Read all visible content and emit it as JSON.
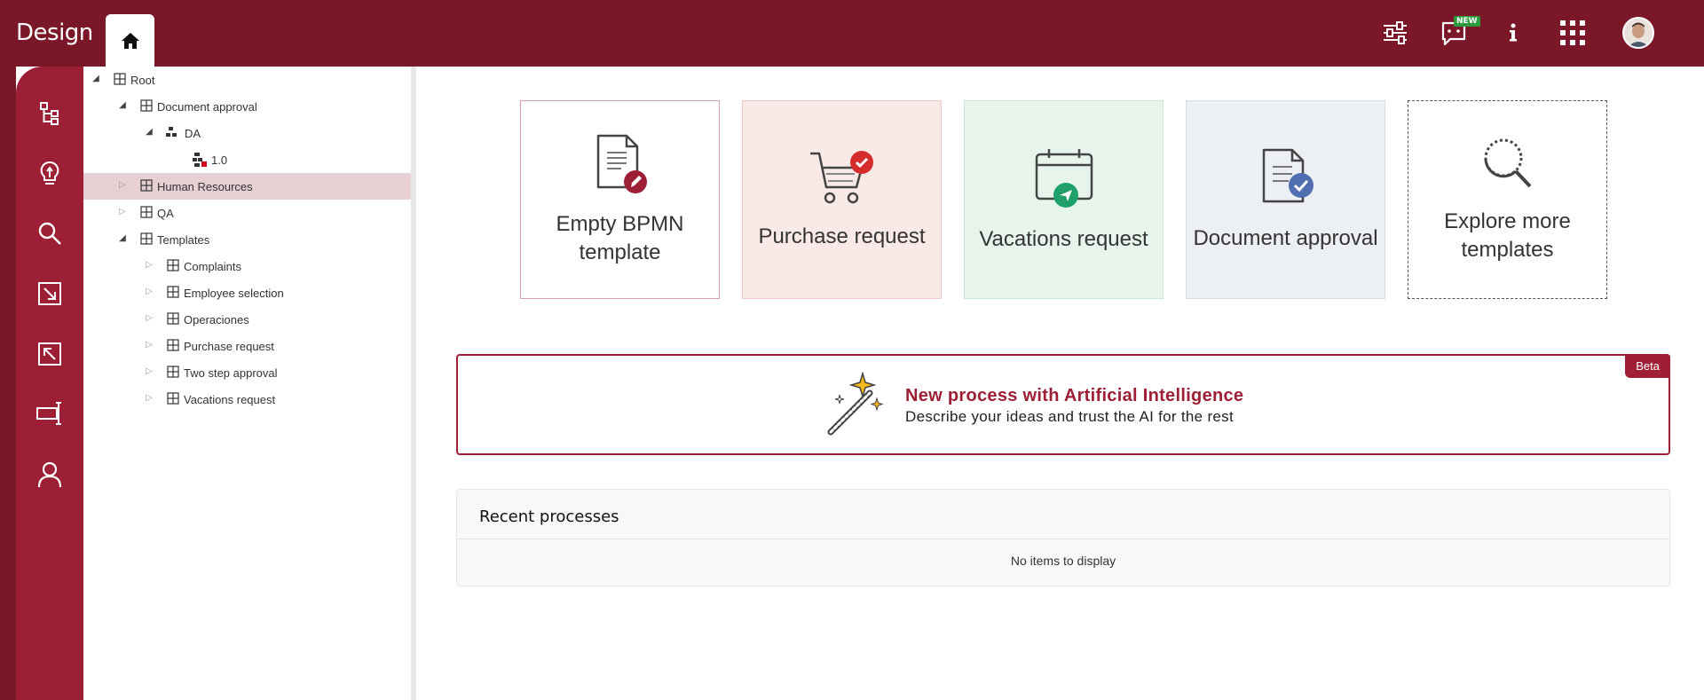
{
  "app": {
    "brand": "Design"
  },
  "header": {
    "home_icon": "home-icon",
    "icons": [
      "sliders-icon",
      "chat-new-icon",
      "info-icon",
      "apps-grid-icon",
      "user-avatar"
    ],
    "new_badge": "NEW"
  },
  "sidebar": {
    "items": [
      "process-tree-icon",
      "idea-bulb-icon",
      "search-icon",
      "import-icon",
      "export-icon",
      "resize-icon",
      "user-icon"
    ]
  },
  "tree": {
    "nodes": [
      {
        "label": "Root",
        "level": 0,
        "expanded": true
      },
      {
        "label": "Document approval",
        "level": 1,
        "expanded": true
      },
      {
        "label": "DA",
        "level": 2,
        "expanded": true
      },
      {
        "label": "1.0",
        "level": 3
      },
      {
        "label": "Human Resources",
        "level": 1,
        "expanded": false,
        "selected": true
      },
      {
        "label": "QA",
        "level": 1,
        "expanded": false
      },
      {
        "label": "Templates",
        "level": 1,
        "expanded": true
      },
      {
        "label": "Complaints",
        "level": 2,
        "expanded": false
      },
      {
        "label": "Employee selection",
        "level": 2,
        "expanded": false
      },
      {
        "label": "Operaciones",
        "level": 2,
        "expanded": false
      },
      {
        "label": "Purchase request",
        "level": 2,
        "expanded": false
      },
      {
        "label": "Two step approval",
        "level": 2,
        "expanded": false
      },
      {
        "label": "Vacations request",
        "level": 2,
        "expanded": false
      }
    ]
  },
  "templates": {
    "cards": [
      {
        "label": "Empty BPMN template",
        "icon": "document-edit-icon"
      },
      {
        "label": "Purchase request",
        "icon": "cart-check-icon"
      },
      {
        "label": "Vacations request",
        "icon": "calendar-send-icon"
      },
      {
        "label": "Document approval",
        "icon": "document-check-icon"
      },
      {
        "label": "Explore more templates",
        "icon": "search-loading-icon"
      }
    ]
  },
  "ai_banner": {
    "badge": "Beta",
    "title": "New process with Artificial Intelligence",
    "subtitle": "Describe your ideas and trust the AI for the rest"
  },
  "recent": {
    "title": "Recent processes",
    "empty": "No items to display"
  },
  "colors": {
    "brand": "#7a1728",
    "sidebar": "#9c1f35",
    "accent": "#a01f37",
    "selected_row": "#e6d0d4"
  }
}
